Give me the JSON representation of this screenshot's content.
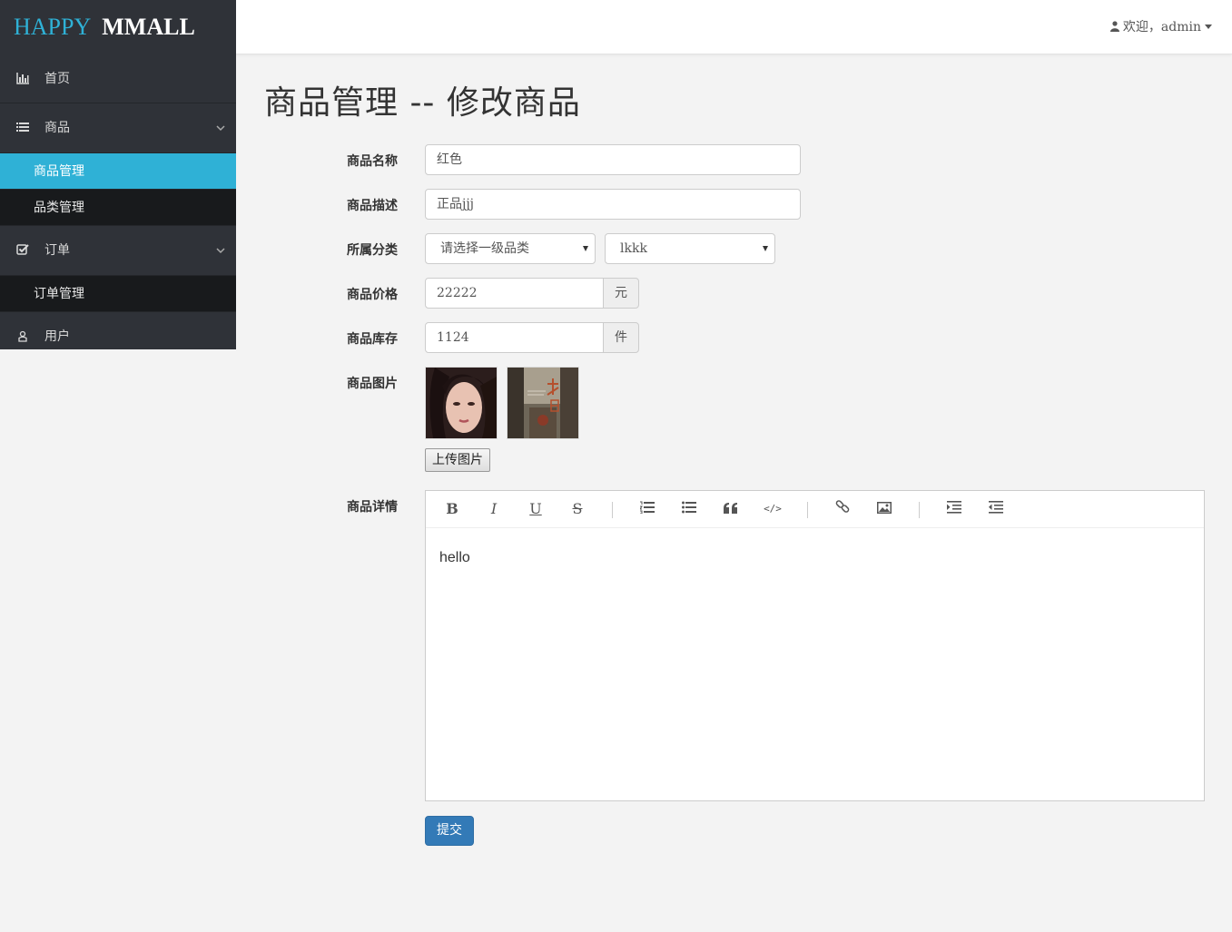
{
  "brand": {
    "part1": "HAPPY",
    "part2": "MMALL"
  },
  "user_menu": {
    "label": "欢迎，admin",
    "icon": "user-icon"
  },
  "sidebar": {
    "items": [
      {
        "label": "首页",
        "icon": "bar-chart-icon"
      },
      {
        "label": "商品",
        "icon": "list-icon",
        "sub": [
          {
            "label": "商品管理",
            "active": true
          },
          {
            "label": "品类管理"
          }
        ]
      },
      {
        "label": "订单",
        "icon": "check-square-icon",
        "sub": [
          {
            "label": "订单管理"
          }
        ]
      },
      {
        "label": "用户",
        "icon": "user-icon"
      }
    ]
  },
  "page": {
    "title": "商品管理 -- 修改商品"
  },
  "form": {
    "name": {
      "label": "商品名称",
      "value": "红色"
    },
    "subtitle": {
      "label": "商品描述",
      "value": "正品jjj"
    },
    "category": {
      "label": "所属分类",
      "first": "请选择一级品类",
      "second": "lkkk"
    },
    "price": {
      "label": "商品价格",
      "value": "22222",
      "unit": "元"
    },
    "stock": {
      "label": "商品库存",
      "value": "1124",
      "unit": "件"
    },
    "images": {
      "label": "商品图片",
      "upload": "上传图片"
    },
    "detail": {
      "label": "商品详情",
      "content": "hello"
    },
    "submit": "提交"
  },
  "toolbar": [
    "bold-icon",
    "italic-icon",
    "underline-icon",
    "strikethrough-icon",
    "ordered-list-icon",
    "unordered-list-icon",
    "quote-icon",
    "code-icon",
    "link-icon",
    "image-icon",
    "indent-icon",
    "outdent-icon"
  ],
  "colors": {
    "sidebar": "#2f3238",
    "accent": "#2fb1d6",
    "primary": "#337ab7"
  }
}
